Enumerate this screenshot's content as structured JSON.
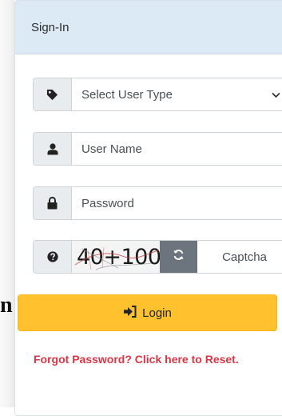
{
  "left_fragment": {
    "text": "n"
  },
  "card": {
    "title": "Sign-In"
  },
  "user_type": {
    "selected": "Select User Type",
    "icon": "tag-icon"
  },
  "username": {
    "placeholder": "User Name",
    "icon": "user-icon"
  },
  "password": {
    "placeholder": "Password",
    "icon": "lock-icon"
  },
  "captcha": {
    "icon": "question-circle-icon",
    "image_text": "40+100=",
    "refresh_icon": "refresh-icon",
    "placeholder": "Captcha"
  },
  "login": {
    "label": "Login",
    "icon": "sign-in-icon",
    "color": "#ffc22e"
  },
  "forgot": {
    "text": "Forgot Password? Click here to Reset.",
    "color": "#dc3545"
  },
  "colors": {
    "header_bg": "#dceaf5",
    "addon_bg": "#e9ecef",
    "refresh_bg": "#6c757d"
  }
}
